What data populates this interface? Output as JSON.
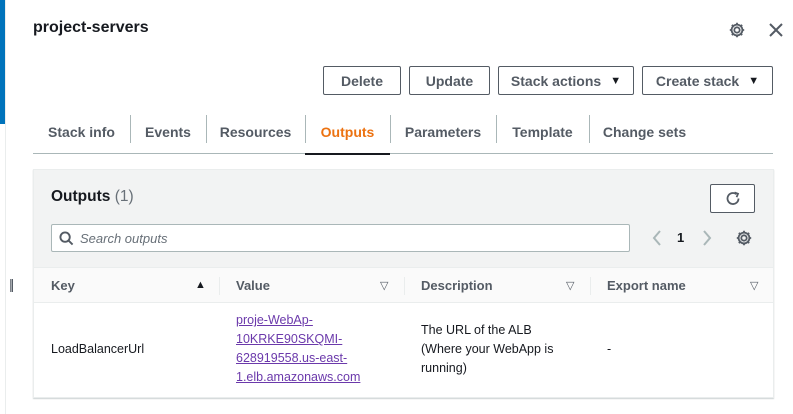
{
  "header": {
    "title": "project-servers"
  },
  "toolbar": {
    "delete_label": "Delete",
    "update_label": "Update",
    "stack_actions_label": "Stack actions",
    "create_stack_label": "Create stack"
  },
  "tabs": [
    {
      "label": "Stack info"
    },
    {
      "label": "Events"
    },
    {
      "label": "Resources"
    },
    {
      "label": "Outputs",
      "active": true
    },
    {
      "label": "Parameters"
    },
    {
      "label": "Template"
    },
    {
      "label": "Change sets"
    }
  ],
  "outputs": {
    "title": "Outputs",
    "count": "(1)",
    "search_placeholder": "Search outputs",
    "page_number": "1",
    "columns": [
      "Key",
      "Value",
      "Description",
      "Export name"
    ],
    "rows": [
      {
        "key": "LoadBalancerUrl",
        "value_lines": [
          "proje-WebAp-",
          "10KRKE90SKQMI-",
          "628919558.us-east-",
          "1.elb.amazonaws.com"
        ],
        "description_lines": [
          "The URL of the ALB",
          "(Where your WebApp is",
          "running)"
        ],
        "export_name": "-"
      }
    ]
  },
  "colors": {
    "active_tab": "#ec7211",
    "link": "#6b39ab",
    "accent_bar": "#0073bb",
    "text": "#16191f",
    "muted_text": "#545b64"
  },
  "icons": {
    "settings": "gear-icon",
    "close": "close-icon",
    "refresh": "refresh-icon",
    "search": "search-icon",
    "prev": "chevron-left-icon",
    "next": "chevron-right-icon",
    "dropdown": "caret-down-icon",
    "sort_ascending": "sort-ascending-icon",
    "sort_descending": "sort-descending-icon",
    "resize": "resize-handle-icon"
  }
}
